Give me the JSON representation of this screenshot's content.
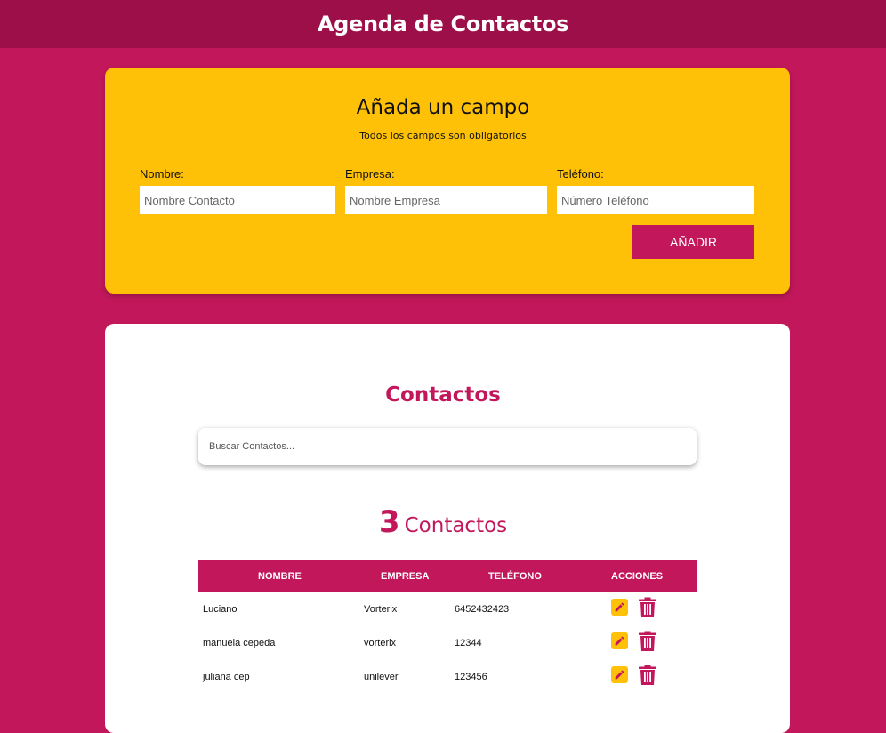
{
  "header": {
    "title": "Agenda de Contactos"
  },
  "form": {
    "title": "Añada un campo",
    "subtitle": "Todos los campos son obligatorios",
    "fields": [
      {
        "label": "Nombre:",
        "placeholder": "Nombre Contacto",
        "value": ""
      },
      {
        "label": "Empresa:",
        "placeholder": "Nombre Empresa",
        "value": ""
      },
      {
        "label": "Teléfono:",
        "placeholder": "Número Teléfono",
        "value": ""
      }
    ],
    "submit_label": "Añadir"
  },
  "contacts": {
    "title": "Contactos",
    "search_placeholder": "Buscar Contactos...",
    "count": "3",
    "count_label": "Contactos",
    "columns": [
      "Nombre",
      "Empresa",
      "Teléfono",
      "Acciones"
    ],
    "rows": [
      {
        "nombre": "Luciano",
        "empresa": "Vorterix",
        "telefono": "6452432423"
      },
      {
        "nombre": "manuela cepeda",
        "empresa": "vorterix",
        "telefono": "12344"
      },
      {
        "nombre": "juliana cep",
        "empresa": "unilever",
        "telefono": "123456"
      }
    ]
  },
  "icons": {
    "edit": "pencil-icon",
    "delete": "trash-icon"
  },
  "colors": {
    "primary": "#c2185b",
    "header": "#9c0f48",
    "accent": "#ffc107"
  }
}
